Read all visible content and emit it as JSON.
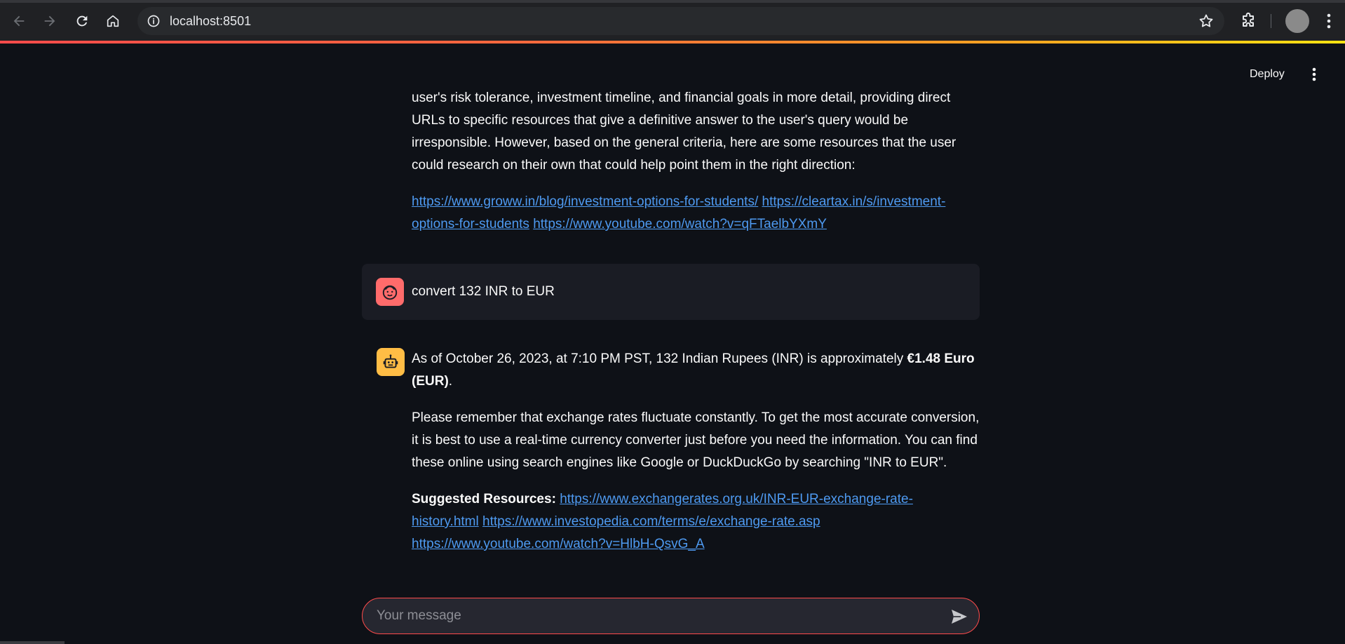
{
  "browser": {
    "url": "localhost:8501"
  },
  "app": {
    "deploy_label": "Deploy"
  },
  "messages": {
    "first_paragraph": "user's risk tolerance, investment timeline, and financial goals in more detail, providing direct URLs to specific resources that give a definitive answer to the user's query would be irresponsible. However, based on the general criteria, here are some resources that the user could research on their own that could help point them in the right direction:",
    "first_links": [
      "https://www.groww.in/blog/investment-options-for-students/",
      "https://cleartax.in/s/investment-options-for-students",
      "https://www.youtube.com/watch?v=qFTaelbYXmY"
    ],
    "user_message": "convert 132 INR to EUR",
    "bot_p1_prefix": "As of October 26, 2023, at 7:10 PM PST, 132 Indian Rupees (INR) is approximately ",
    "bot_p1_bold": "€1.48 Euro (EUR)",
    "bot_p1_suffix": ".",
    "bot_p2": "Please remember that exchange rates fluctuate constantly. To get the most accurate conversion, it is best to use a real-time currency converter just before you need the information. You can find these online using search engines like Google or DuckDuckGo by searching \"INR to EUR\".",
    "bot_resources_label": "Suggested Resources:",
    "bot_links": [
      "https://www.exchangerates.org.uk/INR-EUR-exchange-rate-history.html",
      "https://www.investopedia.com/terms/e/exchange-rate.asp",
      "https://www.youtube.com/watch?v=HlbH-QsvG_A"
    ]
  },
  "chat_input": {
    "placeholder": "Your message"
  },
  "colors": {
    "background": "#0e1117",
    "accent": "#ff4b4b",
    "link": "#4e9af1",
    "user_avatar": "#ff6b6b",
    "bot_avatar": "#ffbd45"
  }
}
